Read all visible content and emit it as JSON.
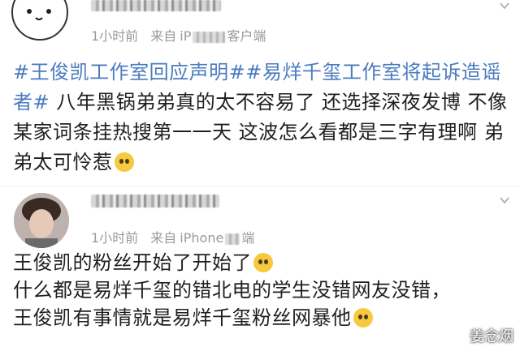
{
  "posts": [
    {
      "meta": {
        "time": "1小时前",
        "from_prefix": "来自",
        "source_start": "iP",
        "source_end": "客户端"
      },
      "segments": [
        {
          "type": "tag",
          "text": "#王俊凯工作室回应声明#"
        },
        {
          "type": "tag",
          "text": "#易烊千玺工作室将起诉造谣者#"
        },
        {
          "type": "text",
          "text": " 八年黑锅弟弟真的太不容易了 还选择深夜发博 不像某家词条挂热搜第一一天 这波怎么看都是三字有理啊 弟弟太可怜惹"
        }
      ],
      "end_emoji": "pleading-face"
    },
    {
      "meta": {
        "time": "1小时前",
        "from_prefix": "来自",
        "source_start": "iPhone",
        "source_end": "端"
      },
      "lines": [
        "王俊凯的粉丝开始了开始了",
        "什么都是易烊千玺的错北电的学生没错网友没错，",
        "王俊凯有事情就是易烊千玺粉丝网暴他"
      ],
      "line_emojis": [
        "fearful-face",
        "",
        "hand-over-mouth-face"
      ]
    }
  ],
  "watermark": "姜念烟"
}
